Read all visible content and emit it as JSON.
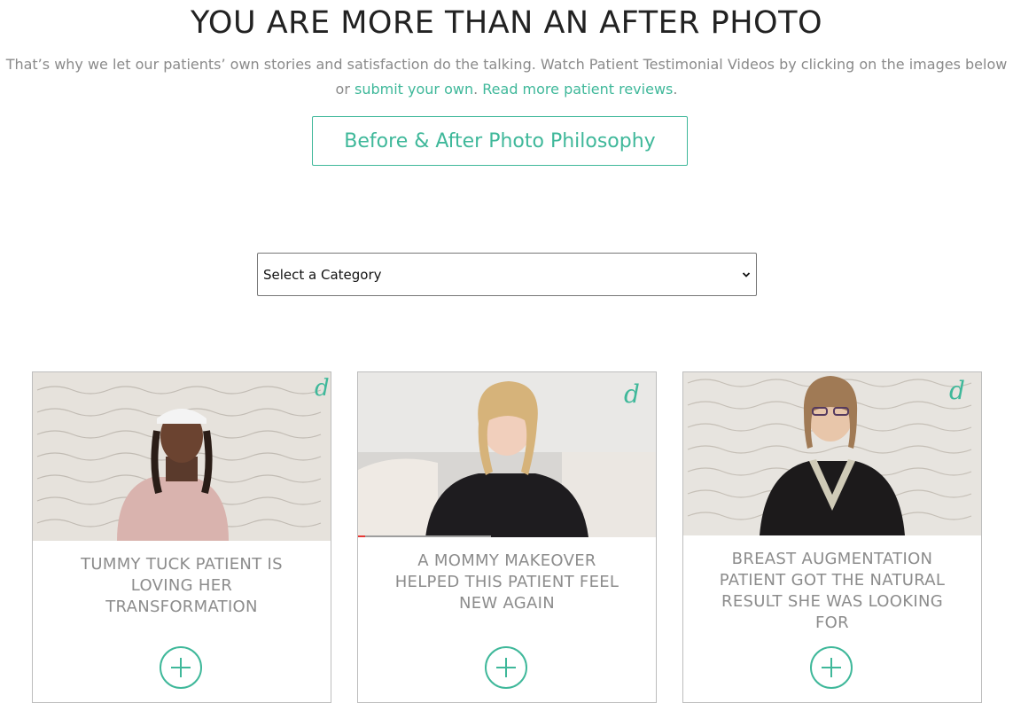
{
  "header": {
    "title": "YOU ARE MORE THAN AN AFTER PHOTO",
    "intro_before": "That’s why we let our patients’ own stories and satisfaction do the talking. Watch Patient Testimonial Videos by clicking on the images below or ",
    "submit_link": "submit your own",
    "intro_mid": ". ",
    "reviews_link": "Read more patient reviews",
    "intro_end": "."
  },
  "philosophy_button": {
    "label": "Before & After Photo Philosophy"
  },
  "category_select": {
    "selected": "Select a Category"
  },
  "cards": [
    {
      "title": "TUMMY TUCK PATIENT IS LOVING HER TRANSFORMATION",
      "thumb_icon": "video-thumbnail"
    },
    {
      "title": "A MOMMY MAKEOVER HELPED THIS PATIENT FEEL NEW AGAIN",
      "thumb_icon": "video-thumbnail"
    },
    {
      "title": "BREAST AUGMENTATION PATIENT GOT THE NATURAL RESULT SHE WAS LOOKING FOR",
      "thumb_icon": "video-thumbnail"
    }
  ],
  "colors": {
    "accent": "#3fb89a",
    "title": "#222222",
    "body_text": "#8a8a8a",
    "card_border": "#bdbdbd"
  }
}
